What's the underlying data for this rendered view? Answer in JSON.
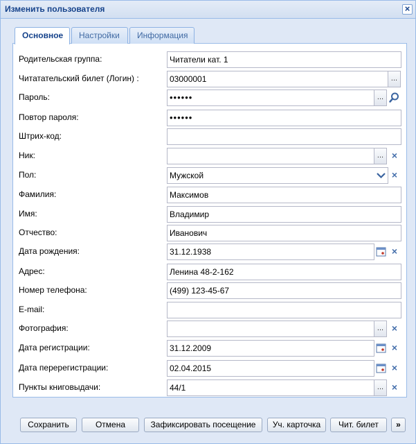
{
  "window": {
    "title": "Изменить пользователя",
    "close_icon": "×"
  },
  "tabs": [
    {
      "label": "Основное",
      "active": true
    },
    {
      "label": "Настройки",
      "active": false
    },
    {
      "label": "Информация",
      "active": false
    }
  ],
  "form": {
    "parent_group": {
      "label": "Родительская группа:",
      "value": "Читатели кат. 1"
    },
    "ticket": {
      "label": "Читатательский билет (Логин) :",
      "value": "03000001"
    },
    "password": {
      "label": "Пароль:",
      "value": "••••••"
    },
    "password_repeat": {
      "label": "Повтор пароля:",
      "value": "••••••"
    },
    "barcode": {
      "label": "Штрих-код:",
      "value": ""
    },
    "nick": {
      "label": "Ник:",
      "value": ""
    },
    "gender": {
      "label": "Пол:",
      "value": "Мужской"
    },
    "surname": {
      "label": "Фамилия:",
      "value": "Максимов"
    },
    "name": {
      "label": "Имя:",
      "value": "Владимир"
    },
    "patronymic": {
      "label": "Отчество:",
      "value": "Иванович"
    },
    "birthdate": {
      "label": "Дата рождения:",
      "value": "31.12.1938"
    },
    "address": {
      "label": "Адрес:",
      "value": "Ленина 48-2-162"
    },
    "phone": {
      "label": "Номер телефона:",
      "value": "(499) 123-45-67"
    },
    "email": {
      "label": "E-mail:",
      "value": ""
    },
    "photo": {
      "label": "Фотография:",
      "value": ""
    },
    "reg_date": {
      "label": "Дата регистрации:",
      "value": "31.12.2009"
    },
    "rereg_date": {
      "label": "Дата перерегистрации:",
      "value": "02.04.2015"
    },
    "points": {
      "label": "Пункты книговыдачи:",
      "value": "44/1"
    }
  },
  "glyphs": {
    "ellipsis": "...",
    "clear": "×",
    "dropdown": "▾",
    "more": "»"
  },
  "toolbar": {
    "save_label": "Сохранить",
    "cancel_label": "Отмена",
    "visit_label": "Зафиксировать посещение",
    "card_label": "Уч. карточка",
    "ticket_label": "Чит. билет",
    "more_label": "»"
  }
}
